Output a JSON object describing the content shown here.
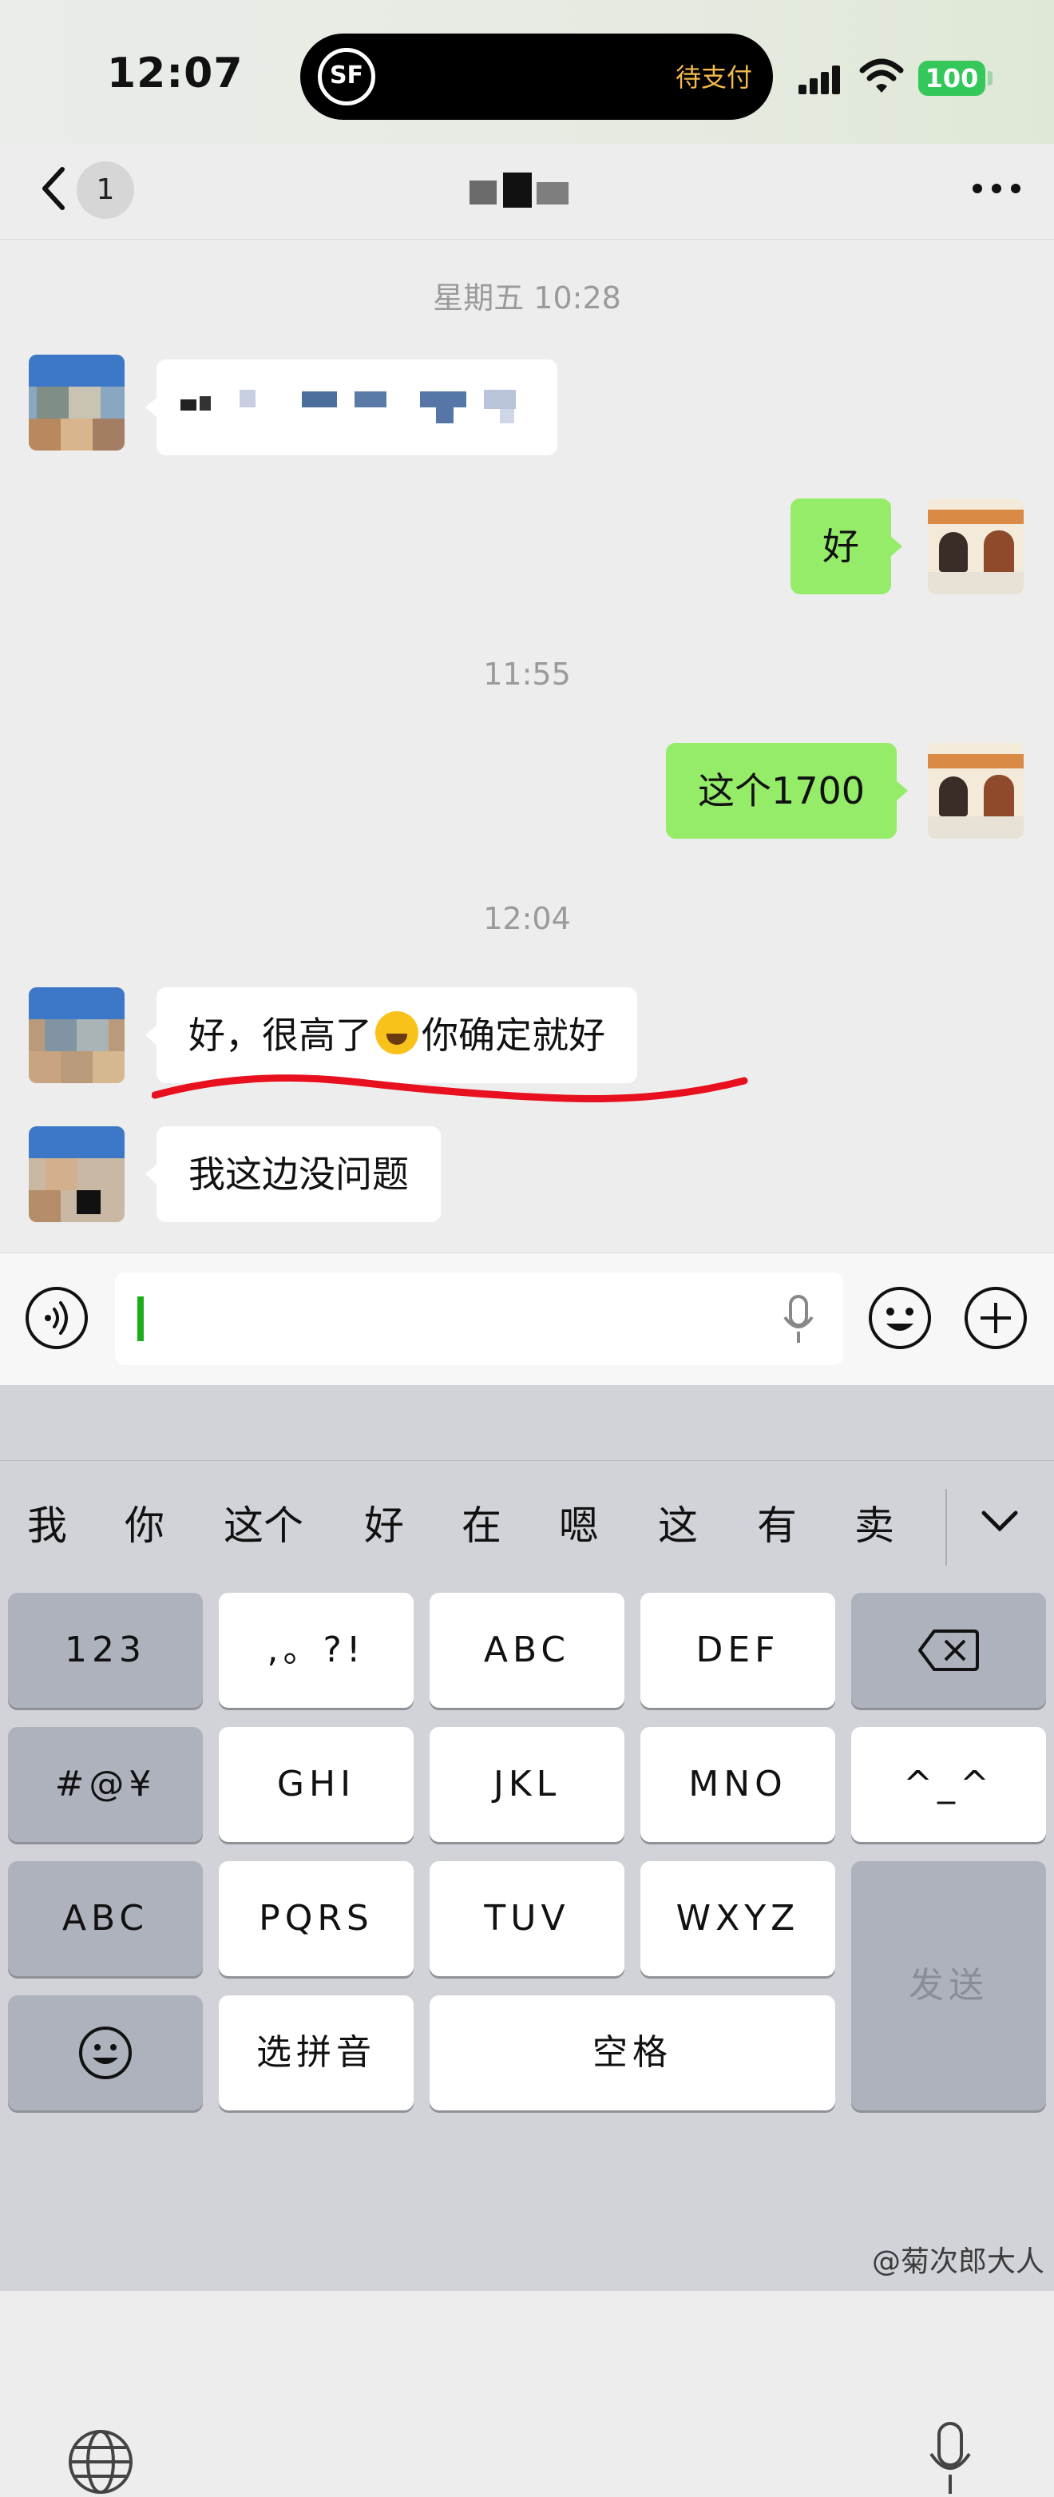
{
  "status": {
    "time": "12:07",
    "island_logo": "SF",
    "island_label": "待支付",
    "battery": "100"
  },
  "nav": {
    "back_badge": "1",
    "title": "",
    "more_icon": "ellipsis-icon"
  },
  "messages": [
    {
      "type": "timestamp",
      "text": "星期五 10:28"
    },
    {
      "type": "incoming",
      "text": ""
    },
    {
      "type": "outgoing",
      "text": "好"
    },
    {
      "type": "timestamp",
      "text": "11:55"
    },
    {
      "type": "outgoing",
      "text": "这个1700"
    },
    {
      "type": "timestamp",
      "text": "12:04"
    },
    {
      "type": "incoming",
      "text_before": "好，很高了",
      "emoji": "face-with-tears-of-joy",
      "text_after": "你确定就好"
    },
    {
      "type": "incoming",
      "text": "我这边没问题"
    }
  ],
  "input": {
    "value": "",
    "voice_icon": "voice-icon",
    "mic_icon": "microphone-icon",
    "emoji_icon": "smiley-icon",
    "plus_icon": "plus-icon"
  },
  "keyboard": {
    "candidates": [
      "我",
      "你",
      "这个",
      "好",
      "在",
      "嗯",
      "这",
      "有",
      "卖"
    ],
    "rows": [
      [
        "123",
        ",。?!",
        "ABC",
        "DEF",
        ""
      ],
      [
        "#@¥",
        "GHI",
        "JKL",
        "MNO",
        "^_^"
      ],
      [
        "ABC",
        "PQRS",
        "TUV",
        "WXYZ",
        "发送"
      ],
      [
        "",
        "选拼音",
        "空格"
      ]
    ],
    "globe_icon": "globe-icon",
    "mic_icon": "microphone-icon"
  },
  "watermark": "@菊次郎大人",
  "colors": {
    "outgoing_bubble": "#95ec69",
    "incoming_bubble": "#ffffff",
    "chat_background": "#ededed",
    "annotation": "#e8101e"
  }
}
